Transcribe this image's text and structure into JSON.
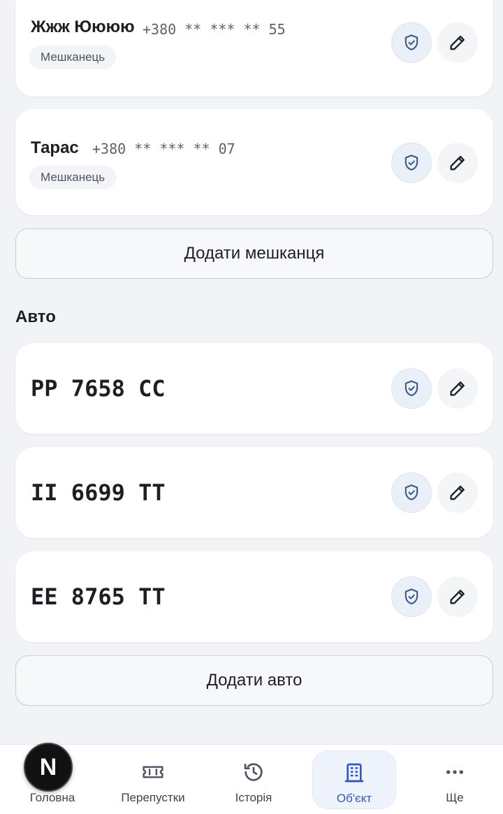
{
  "residents": [
    {
      "name": "Жжж Юююю",
      "phone": "+380 ** *** ** 55",
      "role": "Мешканець"
    },
    {
      "name": "Тарас",
      "phone": "+380 ** *** ** 07",
      "role": "Мешканець"
    }
  ],
  "add_resident_label": "Додати мешканця",
  "cars_section_title": "Авто",
  "cars": [
    {
      "plate": "PP 7658 CC"
    },
    {
      "plate": "II 6699 TT"
    },
    {
      "plate": "EE 8765 TT"
    }
  ],
  "add_car_label": "Додати авто",
  "nav": {
    "items": [
      {
        "label": "Головна",
        "icon": "home-icon"
      },
      {
        "label": "Перепустки",
        "icon": "ticket-icon"
      },
      {
        "label": "Історія",
        "icon": "history-icon"
      },
      {
        "label": "Об'єкт",
        "icon": "building-icon"
      },
      {
        "label": "Ще",
        "icon": "more-icon"
      }
    ],
    "active_index": 3
  },
  "dev_badge": "N",
  "colors": {
    "background": "#f1f3f6",
    "card": "#ffffff",
    "accent": "#2f59c4",
    "shield": "#3b5a86"
  }
}
